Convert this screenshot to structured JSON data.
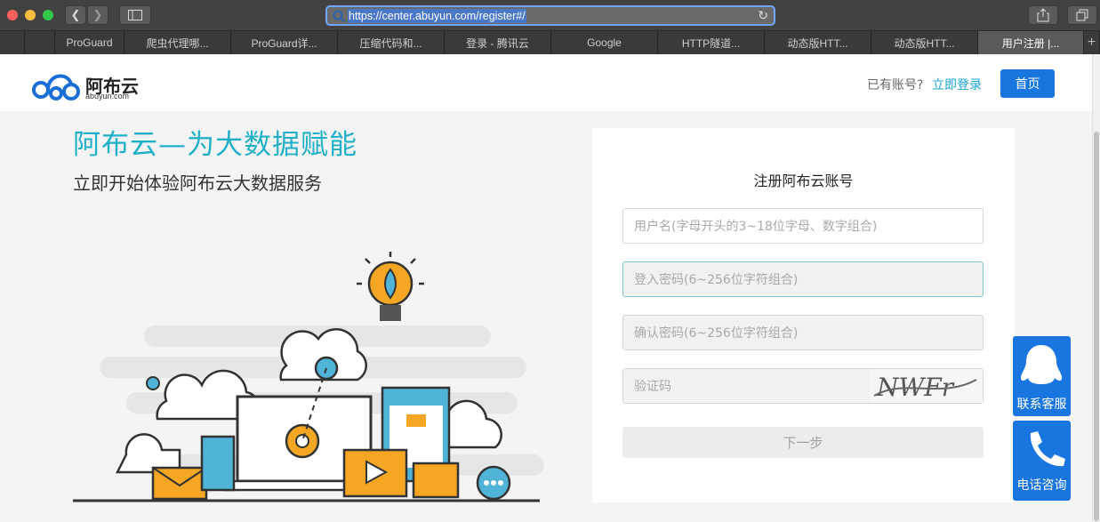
{
  "browser": {
    "url": "https://center.abuyun.com/register#/",
    "tabs": [
      {
        "label": "",
        "width": 28
      },
      {
        "label": "",
        "width": 34
      },
      {
        "label": "ProGuard",
        "width": 78
      },
      {
        "label": "爬虫代理哪...",
        "width": 120
      },
      {
        "label": "ProGuard详...",
        "width": 120
      },
      {
        "label": "压缩代码和...",
        "width": 120
      },
      {
        "label": "登录 - 腾讯云",
        "width": 120
      },
      {
        "label": "Google",
        "width": 120
      },
      {
        "label": "HTTP隧道...",
        "width": 120
      },
      {
        "label": "动态版HTT...",
        "width": 120
      },
      {
        "label": "动态版HTT...",
        "width": 120
      },
      {
        "label": "用户注册 |...",
        "width": 119,
        "active": true
      }
    ],
    "new_tab": "+"
  },
  "header": {
    "logo_text": "阿布云",
    "logo_sub": "abuyun.com",
    "login_prompt": "已有账号?",
    "login_link": "立即登录",
    "home_button": "首页"
  },
  "hero": {
    "title": "阿布云—为大数据赋能",
    "subtitle": "立即开始体验阿布云大数据服务"
  },
  "register_form": {
    "title": "注册阿布云账号",
    "username_placeholder": "用户名(字母开头的3~18位字母、数字组合)",
    "password_placeholder": "登入密码(6~256位字符组合)",
    "confirm_placeholder": "确认密码(6~256位字符组合)",
    "captcha_placeholder": "验证码",
    "captcha_image_text": "NWFr",
    "next_button": "下一步"
  },
  "floating": {
    "qq_label": "联系客服",
    "phone_label": "电话咨询"
  },
  "colors": {
    "accent": "#1976e0",
    "teal": "#1fb0c8",
    "link": "#1aa3d6"
  }
}
